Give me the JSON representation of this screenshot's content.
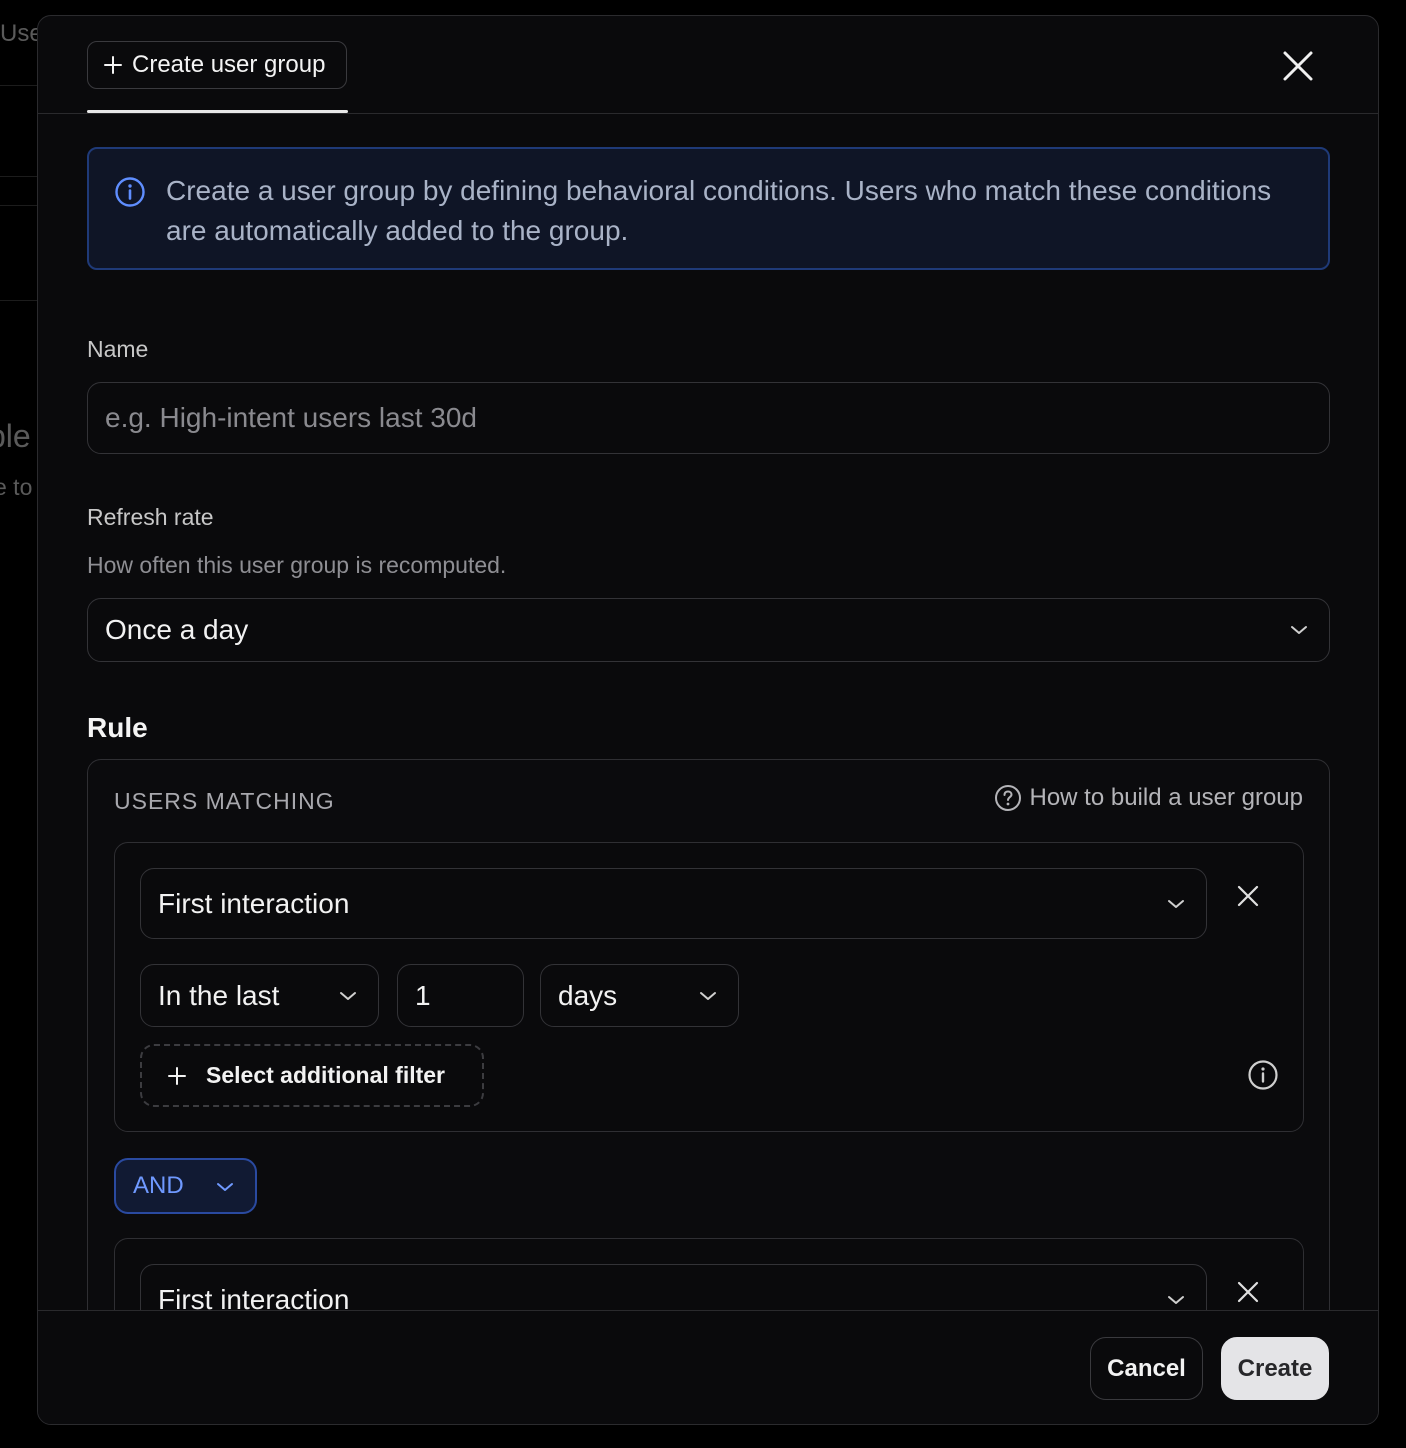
{
  "background": {
    "fragment_1": "Use",
    "fragment_2": "ble",
    "fragment_3": "e to"
  },
  "header": {
    "tab_label": "Create user group"
  },
  "info": {
    "text": "Create a user group by defining behavioral conditions. Users who match these conditions are automatically added to the group."
  },
  "name_field": {
    "label": "Name",
    "value": "",
    "placeholder": "e.g. High-intent users last 30d"
  },
  "refresh": {
    "label": "Refresh rate",
    "help": "How often this user group is recomputed.",
    "selected": "Once a day"
  },
  "rule": {
    "title": "Rule",
    "users_matching": "USERS MATCHING",
    "help_link": "How to build a user group",
    "conditions": [
      {
        "event": "First interaction",
        "time_operator": "In the last",
        "amount": "1",
        "unit": "days",
        "add_filter_label": "Select additional filter"
      },
      {
        "event": "First interaction"
      }
    ],
    "combinator": "AND"
  },
  "footer": {
    "cancel_label": "Cancel",
    "create_label": "Create"
  },
  "colors": {
    "accent_blue": "#6f99ff",
    "info_border": "#1f3a78",
    "create_bg": "#e4e4e7"
  }
}
